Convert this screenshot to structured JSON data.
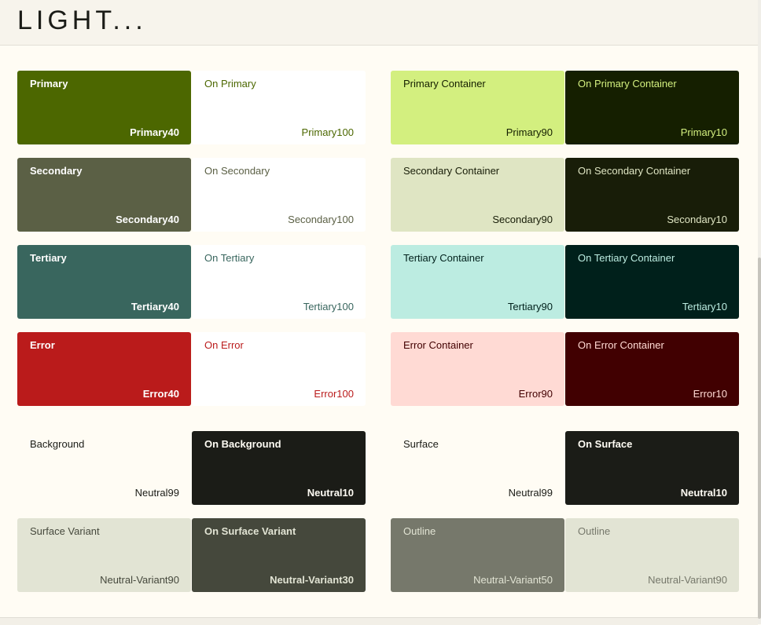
{
  "header": {
    "title": "LIGHT..."
  },
  "tiles": [
    {
      "name": "Primary",
      "tone": "Primary40",
      "bg": "#4c6700",
      "fg": "#ffffff",
      "bold": true
    },
    {
      "name": "On Primary",
      "tone": "Primary100",
      "bg": "#ffffff",
      "fg": "#4c6700",
      "bold": false
    },
    {
      "name": "Primary Container",
      "tone": "Primary90",
      "bg": "#d3ef7f",
      "fg": "#151f00",
      "bold": false
    },
    {
      "name": "On Primary Container",
      "tone": "Primary10",
      "bg": "#151f00",
      "fg": "#d3ef7f",
      "bold": false
    },
    {
      "name": "Secondary",
      "tone": "Secondary40",
      "bg": "#5b6045",
      "fg": "#ffffff",
      "bold": true
    },
    {
      "name": "On Secondary",
      "tone": "Secondary100",
      "bg": "#ffffff",
      "fg": "#5b6045",
      "bold": false
    },
    {
      "name": "Secondary Container",
      "tone": "Secondary90",
      "bg": "#dfe5c3",
      "fg": "#181d08",
      "bold": false
    },
    {
      "name": "On Secondary Container",
      "tone": "Secondary10",
      "bg": "#181d08",
      "fg": "#dfe5c3",
      "bold": false
    },
    {
      "name": "Tertiary",
      "tone": "Tertiary40",
      "bg": "#39665e",
      "fg": "#ffffff",
      "bold": true
    },
    {
      "name": "On Tertiary",
      "tone": "Tertiary100",
      "bg": "#ffffff",
      "fg": "#39665e",
      "bold": false
    },
    {
      "name": "Tertiary Container",
      "tone": "Tertiary90",
      "bg": "#bcece1",
      "fg": "#00201b",
      "bold": false
    },
    {
      "name": "On Tertiary Container",
      "tone": "Tertiary10",
      "bg": "#00201b",
      "fg": "#bcece1",
      "bold": false
    },
    {
      "name": "Error",
      "tone": "Error40",
      "bg": "#ba1b1b",
      "fg": "#ffffff",
      "bold": true
    },
    {
      "name": "On Error",
      "tone": "Error100",
      "bg": "#ffffff",
      "fg": "#ba1b1b",
      "bold": false
    },
    {
      "name": "Error Container",
      "tone": "Error90",
      "bg": "#ffdad4",
      "fg": "#410001",
      "bold": false
    },
    {
      "name": "On Error Container",
      "tone": "Error10",
      "bg": "#410001",
      "fg": "#ffdad4",
      "bold": false
    },
    {
      "name": "Background",
      "tone": "Neutral99",
      "bg": "#fffcf4",
      "fg": "#1b1c17",
      "bold": false
    },
    {
      "name": "On Background",
      "tone": "Neutral10",
      "bg": "#1b1c17",
      "fg": "#fffcf4",
      "bold": true
    },
    {
      "name": "Surface",
      "tone": "Neutral99",
      "bg": "#fffcf4",
      "fg": "#1b1c17",
      "bold": false
    },
    {
      "name": "On Surface",
      "tone": "Neutral10",
      "bg": "#1b1c17",
      "fg": "#fffcf4",
      "bold": true
    },
    {
      "name": "Surface Variant",
      "tone": "Neutral-Variant90",
      "bg": "#e2e4d4",
      "fg": "#45483c",
      "bold": false
    },
    {
      "name": "On Surface Variant",
      "tone": "Neutral-Variant30",
      "bg": "#45483c",
      "fg": "#e2e4d4",
      "bold": true
    },
    {
      "name": "Outline",
      "tone": "Neutral-Variant50",
      "bg": "#76786b",
      "fg": "#e2e4d4",
      "bold": false
    },
    {
      "name": "Outline",
      "tone": "Neutral-Variant90",
      "bg": "#e2e4d4",
      "fg": "#76786b",
      "bold": false
    }
  ]
}
